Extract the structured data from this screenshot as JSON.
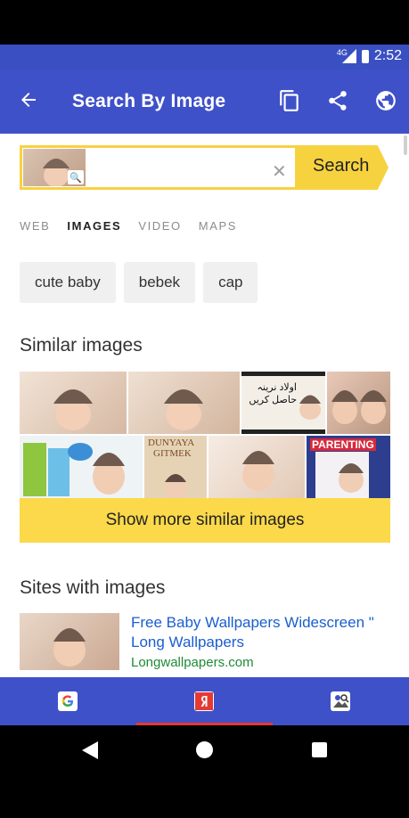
{
  "status": {
    "network": "4G",
    "time": "2:52"
  },
  "appbar": {
    "title": "Search By Image"
  },
  "search": {
    "button_label": "Search",
    "input_value": "",
    "placeholder": ""
  },
  "tabs": [
    {
      "label": "WEB"
    },
    {
      "label": "IMAGES"
    },
    {
      "label": "VIDEO"
    },
    {
      "label": "MAPS"
    }
  ],
  "active_tab": "IMAGES",
  "chips": [
    {
      "label": "cute baby"
    },
    {
      "label": "bebek"
    },
    {
      "label": "cap"
    }
  ],
  "similar": {
    "heading": "Similar images",
    "show_more": "Show more similar images",
    "image_texts": [
      "اولاد نرینہ حاصل کریں",
      "DUNYAYA",
      "GITMEK",
      "PARENTING"
    ]
  },
  "sites": {
    "heading": "Sites with images",
    "items": [
      {
        "title": "Free Baby Wallpapers Widescreen \" Long Wallpapers",
        "url": "Longwallpapers.com"
      }
    ]
  },
  "colors": {
    "accent": "#3f51c9",
    "search_yellow": "#f7d23f",
    "link": "#1a5ecf",
    "url_green": "#1e8a37"
  },
  "icons": [
    "back-arrow-icon",
    "copy-icon",
    "share-icon",
    "globe-icon",
    "clear-icon",
    "magnifier-icon",
    "google-icon",
    "yandex-icon",
    "reverse-image-icon"
  ]
}
